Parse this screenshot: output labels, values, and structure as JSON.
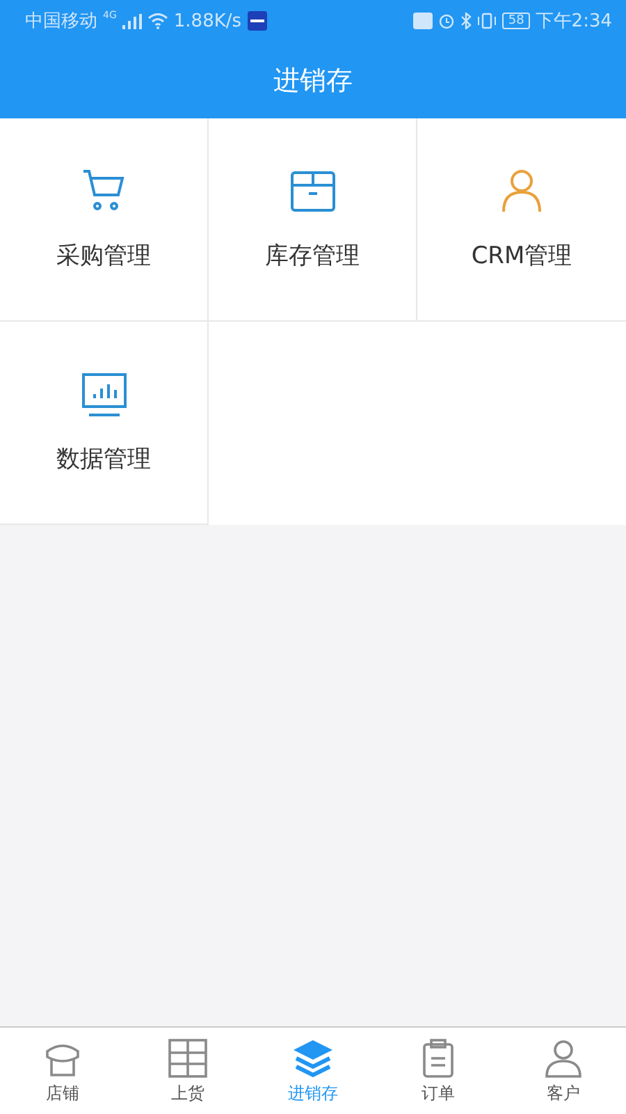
{
  "status_bar": {
    "carrier": "中国移动",
    "network": "4G",
    "speed": "1.88K/s",
    "battery": "58",
    "time": "下午2:34"
  },
  "header": {
    "title": "进销存"
  },
  "modules": [
    {
      "label": "采购管理",
      "kind": "cart",
      "color": "#2a8fd4"
    },
    {
      "label": "库存管理",
      "kind": "box",
      "color": "#2a8fd4"
    },
    {
      "label": "CRM管理",
      "kind": "person",
      "color": "#e9a13b"
    },
    {
      "label": "数据管理",
      "kind": "monitor",
      "color": "#2a8fd4"
    }
  ],
  "tabs": [
    {
      "label": "店铺",
      "kind": "store",
      "selected": false
    },
    {
      "label": "上货",
      "kind": "shelf",
      "selected": false
    },
    {
      "label": "进销存",
      "kind": "layers",
      "selected": true
    },
    {
      "label": "订单",
      "kind": "clipboard",
      "selected": false
    },
    {
      "label": "客户",
      "kind": "user",
      "selected": false
    }
  ]
}
